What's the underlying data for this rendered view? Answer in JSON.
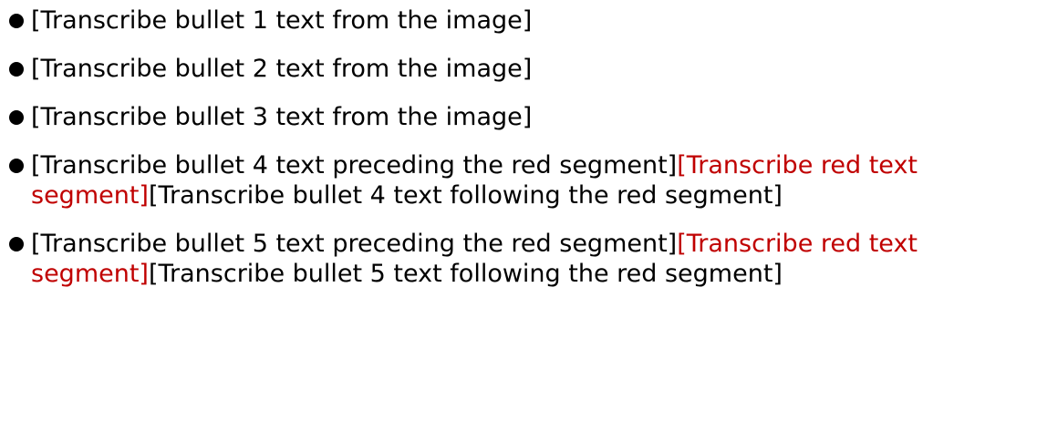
{
  "colors": {
    "text": "#000000",
    "highlight": "#c00000"
  },
  "bullets": [
    {
      "text": "[Transcribe bullet 1 text from the image]"
    },
    {
      "text": "[Transcribe bullet 2 text from the image]"
    },
    {
      "text": "[Transcribe bullet 3 text from the image]"
    },
    {
      "prefix": "[Transcribe bullet 4 text preceding the red segment]",
      "highlight": "[Transcribe red text segment]",
      "suffix": "[Transcribe bullet 4 text following the red segment]"
    },
    {
      "prefix": "[Transcribe bullet 5 text preceding the red segment]",
      "highlight": "[Transcribe red text segment]",
      "suffix": "[Transcribe bullet 5 text following the red segment]"
    }
  ]
}
